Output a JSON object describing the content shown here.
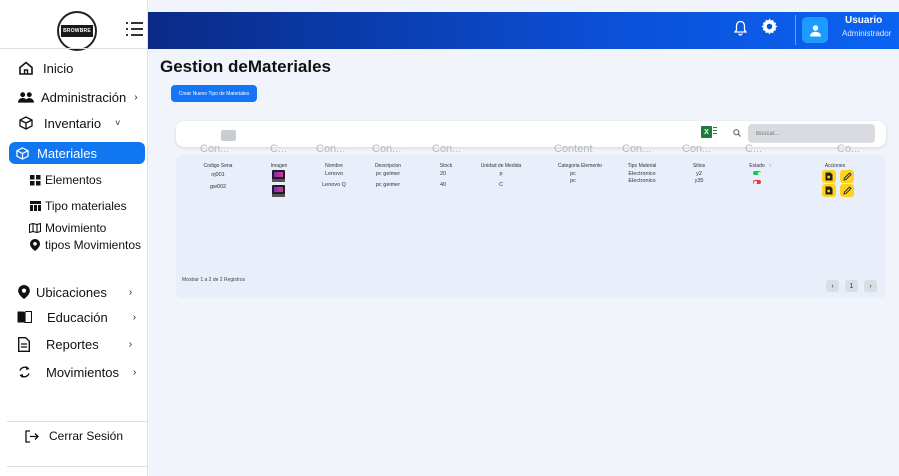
{
  "brand": {
    "logo_text": "BROWBRE"
  },
  "sidebar": {
    "items": [
      {
        "label": "Inicio",
        "icon": "home-icon"
      },
      {
        "label": "Administración",
        "icon": "users-icon",
        "chevron": "›"
      },
      {
        "label": "Inventario",
        "icon": "cube-icon",
        "chevron": "˅"
      },
      {
        "label": "Materiales",
        "icon": "cube-icon",
        "active": true
      },
      {
        "label": "Elementos",
        "icon": "grid-icon"
      },
      {
        "label": "Tipo materiales",
        "icon": "table-icon"
      },
      {
        "label": "Movimiento",
        "icon": "map-icon"
      },
      {
        "label": "tipos Movimientos",
        "icon": "pin-icon"
      },
      {
        "label": "Ubicaciones",
        "icon": "pin-icon",
        "chevron": "›"
      },
      {
        "label": "Educación",
        "icon": "book-icon",
        "chevron": "›"
      },
      {
        "label": "Reportes",
        "icon": "file-icon",
        "chevron": "›"
      },
      {
        "label": "Movimientos",
        "icon": "refresh-icon",
        "chevron": "›"
      }
    ],
    "logout": "Cerrar Sesión"
  },
  "topbar": {
    "user_name": "Usuario",
    "user_role": "Administrador"
  },
  "page": {
    "title": "Gestion deMateriales",
    "create_button": "Crear Nuevo Tipo de Materiales"
  },
  "search": {
    "placeholder": "Buscar..."
  },
  "ghost_headers": [
    "Con...",
    "C...",
    "Con...",
    "Con...",
    "Con...",
    "Content",
    "Con...",
    "Con...",
    "C...",
    "Co..."
  ],
  "table": {
    "headers": [
      "Codigo Sena",
      "Imagen",
      "Nombre",
      "Descripcion",
      "Stock",
      "Unidad de Medida",
      "Categoria Elemento",
      "Tipo Material",
      "Sitios",
      "Estado",
      "Acciones"
    ],
    "rows": [
      {
        "codigo": "nj001",
        "nombre": "Lenovo",
        "descripcion": "pc geimer",
        "stock": "20",
        "unidad": "p",
        "categoria": "pc",
        "tipo": "Electronico",
        "sitio": "y2",
        "estado": "on"
      },
      {
        "codigo": "gw002",
        "nombre": "Lenovo Q",
        "descripcion": "pc geimer",
        "stock": "40",
        "unidad": "C",
        "categoria": "pc",
        "tipo": "Electronico",
        "sitio": "y35",
        "estado": "off"
      }
    ],
    "footer": "Mostrar 1 a 2 de 2 Registros",
    "pager": [
      "‹",
      "1",
      "›"
    ]
  }
}
